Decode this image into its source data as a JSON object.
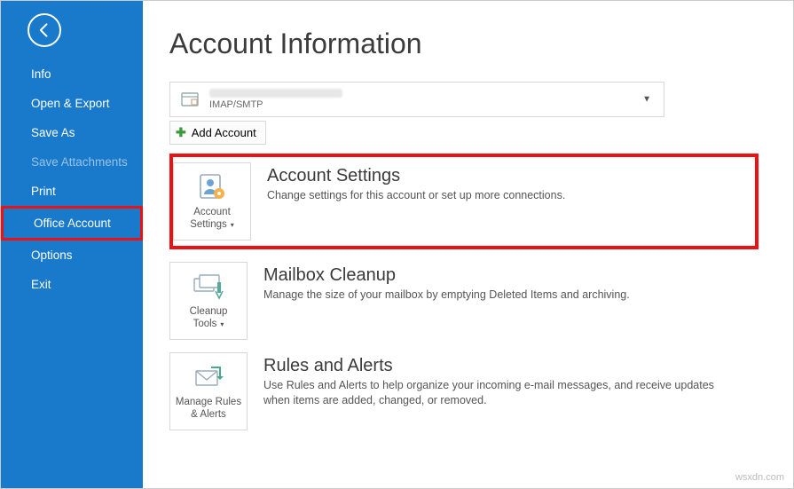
{
  "sidebar": {
    "items": [
      {
        "label": "Info"
      },
      {
        "label": "Open & Export"
      },
      {
        "label": "Save As"
      },
      {
        "label": "Save Attachments"
      },
      {
        "label": "Print"
      },
      {
        "label": "Office Account"
      },
      {
        "label": "Options"
      },
      {
        "label": "Exit"
      }
    ]
  },
  "page_title": "Account Information",
  "account_selector": {
    "protocol": "IMAP/SMTP"
  },
  "add_account_label": "Add Account",
  "sections": {
    "account_settings": {
      "tile_line1": "Account",
      "tile_line2": "Settings",
      "title": "Account Settings",
      "desc": "Change settings for this account or set up more connections."
    },
    "mailbox_cleanup": {
      "tile_line1": "Cleanup",
      "tile_line2": "Tools",
      "title": "Mailbox Cleanup",
      "desc": "Manage the size of your mailbox by emptying Deleted Items and archiving."
    },
    "rules_alerts": {
      "tile_line1": "Manage Rules",
      "tile_line2": "& Alerts",
      "title": "Rules and Alerts",
      "desc": "Use Rules and Alerts to help organize your incoming e-mail messages, and receive updates when items are added, changed, or removed."
    }
  },
  "watermark": "wsxdn.com"
}
